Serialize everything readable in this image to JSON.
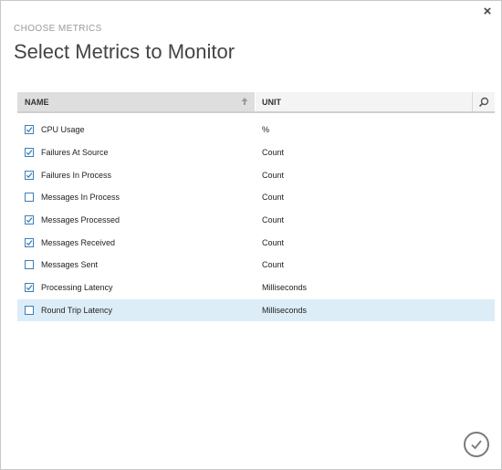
{
  "dialog": {
    "subtitle": "CHOOSE METRICS",
    "title": "Select Metrics to Monitor",
    "close_glyph": "×"
  },
  "table": {
    "columns": {
      "name": "NAME",
      "unit": "UNIT"
    },
    "icons": {
      "sort": "sort-ascending-icon",
      "search": "search-icon"
    },
    "rows": [
      {
        "name": "CPU Usage",
        "unit": "%",
        "checked": true
      },
      {
        "name": "Failures At Source",
        "unit": "Count",
        "checked": true
      },
      {
        "name": "Failures In Process",
        "unit": "Count",
        "checked": true
      },
      {
        "name": "Messages In Process",
        "unit": "Count",
        "checked": false
      },
      {
        "name": "Messages Processed",
        "unit": "Count",
        "checked": true
      },
      {
        "name": "Messages Received",
        "unit": "Count",
        "checked": true
      },
      {
        "name": "Messages Sent",
        "unit": "Count",
        "checked": false
      },
      {
        "name": "Processing Latency",
        "unit": "Milliseconds",
        "checked": true
      },
      {
        "name": "Round Trip Latency",
        "unit": "Milliseconds",
        "checked": false,
        "selected": true
      }
    ]
  },
  "footer": {
    "confirm_icon": "checkmark-circle-icon"
  },
  "colors": {
    "accent": "#3b7fb8",
    "selected_row": "#dcedf8",
    "header_bg": "#e5e5e5"
  }
}
